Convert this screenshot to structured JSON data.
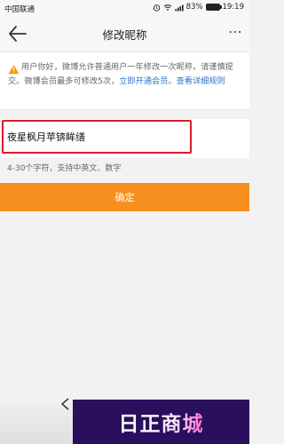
{
  "status_bar": {
    "carrier": "中国联通",
    "battery": "83%",
    "time": "19:19"
  },
  "nav": {
    "title": "修改昵称",
    "more": "⋯",
    "back_icon": "back-arrow-icon"
  },
  "notice": {
    "text_main": "用户你好，微博允许普通用户一年修改一次昵称，请谨慎提交。微博会员最多可修改5次，",
    "link_open_member": "立即开通会员",
    "text_sep": "。",
    "link_rules": "查看详细规则",
    "warning_icon": "warning-icon"
  },
  "nickname_input": {
    "value": "夜星枫月苹锛眸缮"
  },
  "hint": "4-30个字符，支持中英文、数字",
  "confirm_button": "确定",
  "watermark_text": "日正商城",
  "colors": {
    "accent_orange": "#f7901e",
    "highlight_red": "#d81b2a",
    "link_blue": "#2f73c8"
  }
}
